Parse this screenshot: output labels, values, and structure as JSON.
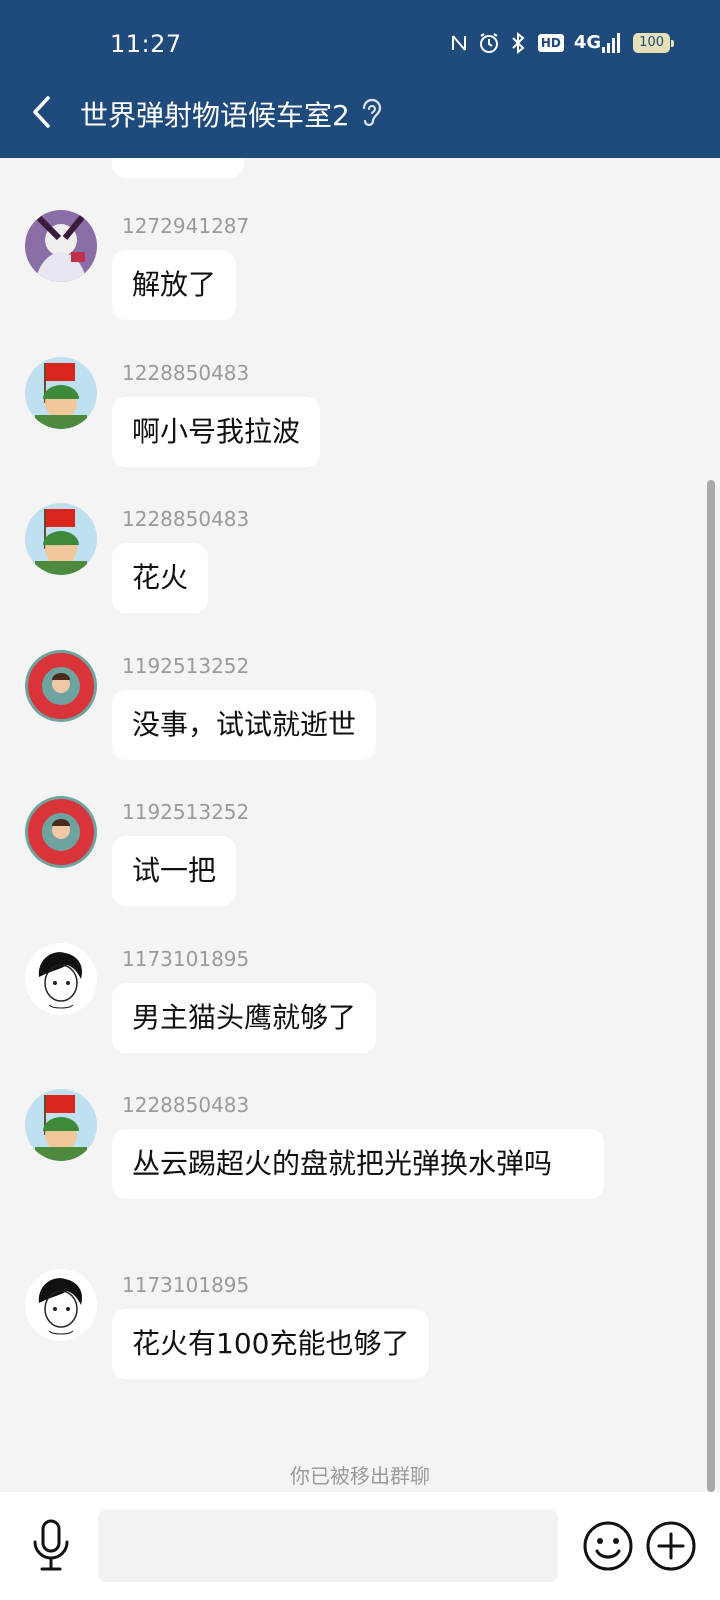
{
  "status_bar": {
    "time": "11:27",
    "network": "4G",
    "battery": "100"
  },
  "header": {
    "title": "世界弹射物语候车室2"
  },
  "messages": [
    {
      "sender": "1272941287",
      "text": "解放了",
      "avatar": "girl-anime-avatar"
    },
    {
      "sender": "1228850483",
      "text": "啊小号我拉波",
      "avatar": "flag-soldier-avatar"
    },
    {
      "sender": "1228850483",
      "text": "花火",
      "avatar": "flag-soldier-avatar"
    },
    {
      "sender": "1192513252",
      "text": "没事，试试就逝世",
      "avatar": "swim-ring-avatar"
    },
    {
      "sender": "1192513252",
      "text": "试一把",
      "avatar": "swim-ring-avatar"
    },
    {
      "sender": "1173101895",
      "text": "男主猫头鹰就够了",
      "avatar": "sketch-boy-avatar"
    },
    {
      "sender": "1228850483",
      "text": "丛云踢超火的盘就把光弹换水弹吗",
      "avatar": "flag-soldier-avatar"
    },
    {
      "sender": "1173101895",
      "text": "花火有100充能也够了",
      "avatar": "sketch-boy-avatar"
    }
  ],
  "notice": "你已被移出群聊",
  "colors": {
    "header_bg": "#1e4a7c",
    "chat_bg": "#f4f4f4",
    "bubble_bg": "#ffffff"
  }
}
